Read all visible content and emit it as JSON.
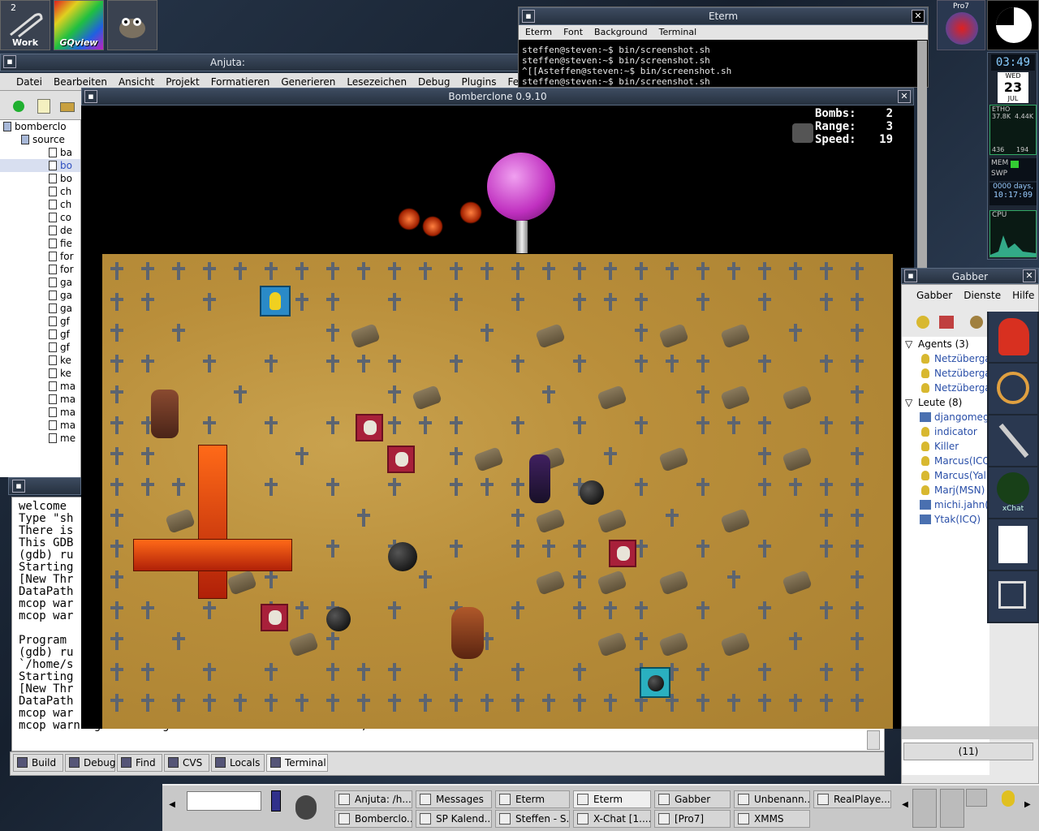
{
  "desktop": {
    "workspace_number": "2",
    "workspace_label": "Work"
  },
  "launchers": [
    {
      "label": "GQview"
    },
    {
      "label": ""
    }
  ],
  "eterm": {
    "title": "Eterm",
    "menu": [
      "Eterm",
      "Font",
      "Background",
      "Terminal"
    ],
    "lines": [
      "steffen@steven:~$ bin/screenshot.sh",
      "steffen@steven:~$ bin/screenshot.sh",
      "^[[Asteffen@steven:~$ bin/screenshot.sh",
      "steffen@steven:~$ bin/screenshot.sh"
    ]
  },
  "anjuta": {
    "title": "Anjuta: /home/steffen/Daten/Programmierung/Linux/bomberclone",
    "menu": [
      "Datei",
      "Bearbeiten",
      "Ansicht",
      "Projekt",
      "Formatieren",
      "Generieren",
      "Lesezeichen",
      "Debug",
      "Plugins",
      "Fens"
    ],
    "tree": [
      "bomberclo",
      "source",
      "ba",
      "bo",
      "bo",
      "ch",
      "ch",
      "co",
      "de",
      "fie",
      "for",
      "for",
      "ga",
      "ga",
      "ga",
      "gf",
      "gf",
      "gf",
      "ke",
      "ke",
      "ma",
      "ma",
      "ma",
      "ma",
      "me"
    ],
    "console": [
      "welcome",
      "Type \"sh",
      "There is",
      "This GDB",
      "(gdb) ru",
      "Starting",
      "[New Thr",
      "DataPath",
      "mcop war",
      "mcop war",
      "",
      "Program",
      "(gdb) ru",
      "`/home/s",
      "Starting",
      "[New Thr",
      "DataPath",
      "mcop war",
      "mcop warning: a...  signal handler  ...  ...  ...  ...  ,  ..."
    ],
    "tabs": [
      "Build",
      "Debug",
      "Find",
      "CVS",
      "Locals",
      "Terminal"
    ]
  },
  "game": {
    "title": "Bomberclone 0.9.10",
    "stats": [
      {
        "label": "Bombs:",
        "value": "2"
      },
      {
        "label": "Range:",
        "value": "3"
      },
      {
        "label": "Speed:",
        "value": "19"
      }
    ]
  },
  "gkrellm": {
    "host": "ETHO",
    "clock": "03:49",
    "day": "WED",
    "date": "23",
    "month": "JUL",
    "net_in": "37.8K",
    "net_out": "4.44K",
    "net_a": "436",
    "net_b": "194",
    "mem": "MEM",
    "swp": "SWP",
    "uptime": "0000 days,",
    "time": "10:17:09",
    "cpu": "CPU",
    "pro7": "Pro7"
  },
  "gabber": {
    "title": "Gabber",
    "menu": [
      "Gabber",
      "Dienste",
      "Hilfe"
    ],
    "groups": [
      {
        "name": "Agents (3)",
        "items": [
          {
            "name": "Netzüberga",
            "icon": "bulb"
          },
          {
            "name": "Netzüberga",
            "icon": "bulb"
          },
          {
            "name": "Netzüberga",
            "icon": "bulb"
          }
        ]
      },
      {
        "name": "Leute (8)",
        "items": [
          {
            "name": "djangomega",
            "icon": "icq"
          },
          {
            "name": "indicator",
            "icon": "bulb"
          },
          {
            "name": "Killer",
            "icon": "bulb"
          },
          {
            "name": "Marcus(ICQ",
            "icon": "bulb"
          },
          {
            "name": "Marcus(Yal",
            "icon": "bulb"
          },
          {
            "name": "Marj(MSN)",
            "icon": "bulb"
          },
          {
            "name": "michi.jahn(M",
            "icon": "icq"
          },
          {
            "name": "Ytak(ICQ)",
            "icon": "icq"
          }
        ]
      }
    ],
    "status_count": "(11)"
  },
  "dock": {
    "xchat": "xChat"
  },
  "taskbar": {
    "row1": [
      "Anjuta: /h...",
      "Messages",
      "Eterm",
      "Eterm",
      "Gabber",
      "Unbenann...",
      "RealPlaye..."
    ],
    "row2": [
      "Bomberclo...",
      "SP Kalend...",
      "Steffen - S...",
      "X-Chat [1....",
      "[Pro7]",
      "XMMS"
    ]
  }
}
